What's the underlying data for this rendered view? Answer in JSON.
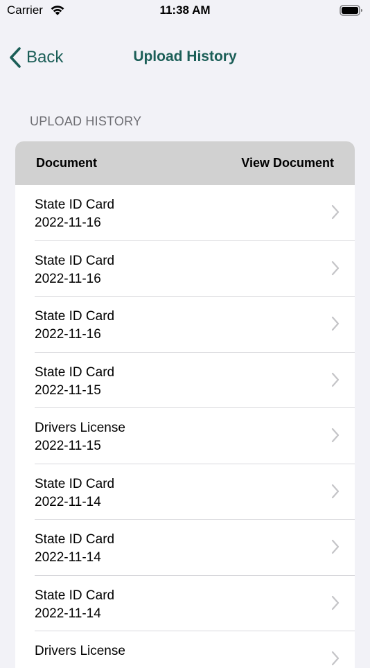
{
  "status_bar": {
    "carrier": "Carrier",
    "time": "11:38 AM"
  },
  "nav": {
    "back_label": "Back",
    "title": "Upload History"
  },
  "section": {
    "header": "UPLOAD HISTORY"
  },
  "table": {
    "columns": {
      "document": "Document",
      "view": "View Document"
    },
    "rows": [
      {
        "doc": "State ID Card",
        "date": "2022-11-16"
      },
      {
        "doc": "State ID Card",
        "date": "2022-11-16"
      },
      {
        "doc": "State ID Card",
        "date": "2022-11-16"
      },
      {
        "doc": "State ID Card",
        "date": "2022-11-15"
      },
      {
        "doc": "Drivers License",
        "date": "2022-11-15"
      },
      {
        "doc": "State ID Card",
        "date": "2022-11-14"
      },
      {
        "doc": "State ID Card",
        "date": "2022-11-14"
      },
      {
        "doc": "State ID Card",
        "date": "2022-11-14"
      },
      {
        "doc": "Drivers License",
        "date": ""
      }
    ]
  },
  "icons": {
    "back": "chevron-left-icon",
    "row": "chevron-right-icon",
    "wifi": "wifi-icon",
    "battery": "battery-icon"
  },
  "colors": {
    "accent": "#1b5e57",
    "background": "#f2f2f7",
    "table_header": "#d1d1d1"
  }
}
